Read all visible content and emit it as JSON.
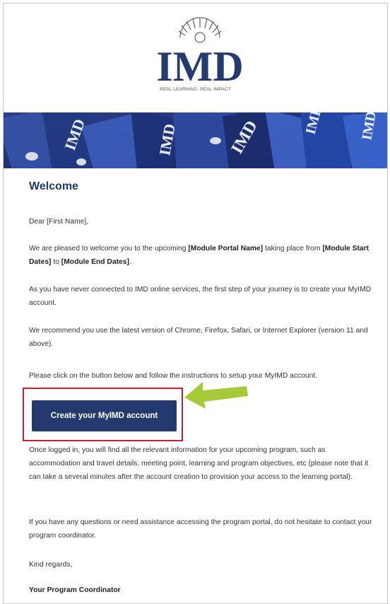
{
  "brand": {
    "logo_text": "IMD",
    "tagline": "REAL LEARNING. REAL IMPACT",
    "primary_color": "#233a72",
    "cta_color": "#243a6e",
    "highlight_color": "#c8202e",
    "arrow_color": "#a6c938"
  },
  "email": {
    "heading": "Welcome",
    "greeting": "Dear [First Name],",
    "intro": {
      "part1": "We are pleased to welcome you to the upcoming ",
      "portal_name": "[Module Portal Name]",
      "part2": " taking place from ",
      "start_dates": "[Module Start Dates]",
      "part3": " to ",
      "end_dates": "[Module End Dates]",
      "part4": "."
    },
    "first_step": "As you have never connected to IMD online services, the first step of your journey is to create your MyIMD account.",
    "browsers": "We recommend you use the latest version of Chrome, Firefox, Safari, or Internet Explorer (version 11 and above).",
    "instruction": "Please click on the button below and follow the instructions to setup your MyIMD account.",
    "cta_label": "Create your MyIMD account",
    "after_login": "Once logged in, you will find all the relevant information for your upcoming program, such as accommodation and travel details, meeting point, learning and program objectives, etc (please note that it can take a several minutes after the account creation to provision your access to the learning portal).",
    "questions": "If you have any questions or need assistance accessing the program portal, do not hesitate to contact your program coordinator.",
    "closing": "Kind regards,",
    "signature": "Your Program Coordinator"
  },
  "icons": {
    "logo": "imd-sunburst-logo",
    "banner": "lanyard-banner-image",
    "annotation": "green-arrow-icon"
  }
}
